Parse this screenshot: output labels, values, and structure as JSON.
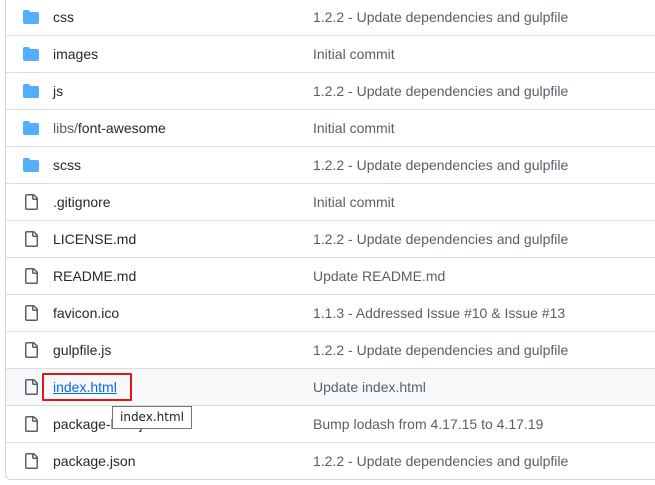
{
  "files": [
    {
      "type": "folder",
      "icon": "folder-icon",
      "name": "css",
      "commit": "1.2.2 - Update dependencies and gulpfile"
    },
    {
      "type": "folder",
      "icon": "folder-icon",
      "name": "images",
      "commit": "Initial commit"
    },
    {
      "type": "folder",
      "icon": "folder-icon",
      "name": "js",
      "commit": "1.2.2 - Update dependencies and gulpfile"
    },
    {
      "type": "folder",
      "icon": "folder-icon",
      "name_prefix": "libs/",
      "name": "font-awesome",
      "commit": "Initial commit"
    },
    {
      "type": "folder",
      "icon": "folder-icon",
      "name": "scss",
      "commit": "1.2.2 - Update dependencies and gulpfile"
    },
    {
      "type": "file",
      "icon": "file-icon",
      "name": ".gitignore",
      "commit": "Initial commit"
    },
    {
      "type": "file",
      "icon": "file-icon",
      "name": "LICENSE.md",
      "commit": "1.2.2 - Update dependencies and gulpfile"
    },
    {
      "type": "file",
      "icon": "file-icon",
      "name": "README.md",
      "commit": "Update README.md"
    },
    {
      "type": "file",
      "icon": "file-icon",
      "name": "favicon.ico",
      "commit": "1.1.3 - Addressed Issue #10 & Issue #13"
    },
    {
      "type": "file",
      "icon": "file-icon",
      "name": "gulpfile.js",
      "commit": "1.2.2 - Update dependencies and gulpfile"
    },
    {
      "type": "file",
      "icon": "file-icon",
      "name": "index.html",
      "commit": "Update index.html",
      "hovered": true,
      "highlighted": true
    },
    {
      "type": "file",
      "icon": "file-icon",
      "name": "package-lock.json",
      "commit": "Bump lodash from 4.17.15 to 4.17.19"
    },
    {
      "type": "file",
      "icon": "file-icon",
      "name": "package.json",
      "commit": "1.2.2 - Update dependencies and gulpfile"
    }
  ],
  "tooltip": {
    "text": "index.html"
  },
  "colors": {
    "folder": "#54aeff",
    "file_icon": "#57606a",
    "link": "#0969da",
    "highlight": "#e0161a",
    "row_hover": "#f6f8fa"
  }
}
